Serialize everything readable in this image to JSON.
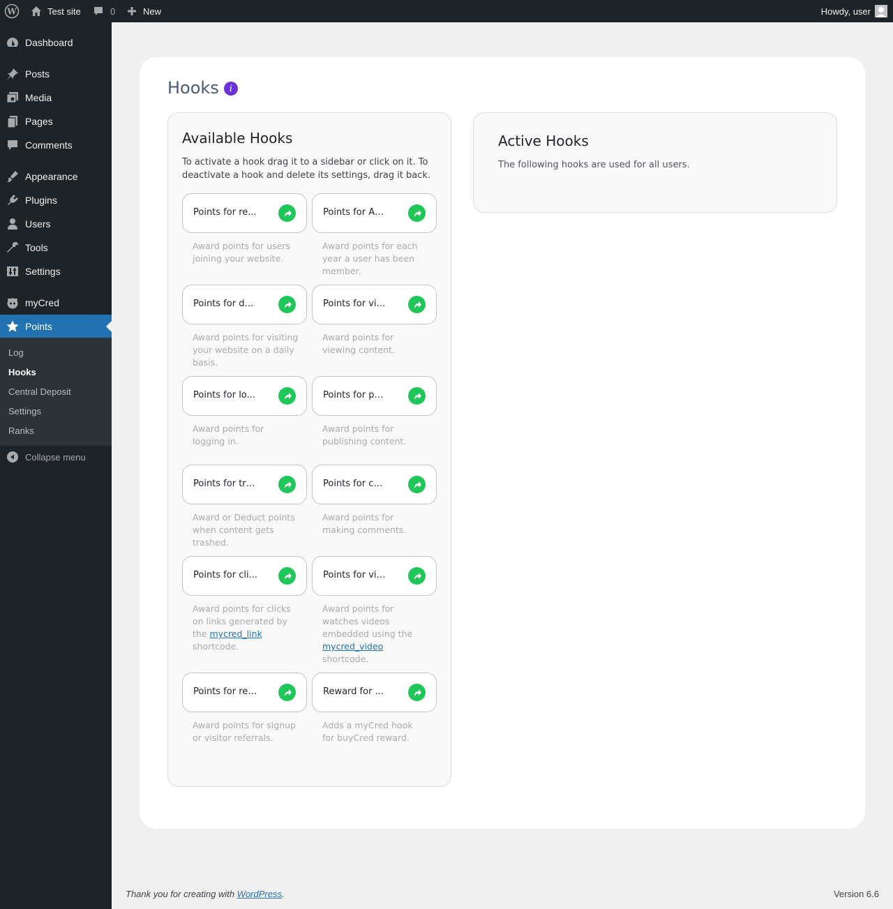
{
  "adminbar": {
    "site_name": "Test site",
    "comments_count": "0",
    "new_label": "New",
    "howdy": "Howdy, user"
  },
  "sidebar": {
    "items": [
      {
        "label": "Dashboard",
        "icon": "dashboard-icon"
      },
      {
        "label": "Posts",
        "icon": "pin-icon"
      },
      {
        "label": "Media",
        "icon": "media-icon"
      },
      {
        "label": "Pages",
        "icon": "pages-icon"
      },
      {
        "label": "Comments",
        "icon": "comment-icon"
      },
      {
        "label": "Appearance",
        "icon": "brush-icon"
      },
      {
        "label": "Plugins",
        "icon": "plug-icon"
      },
      {
        "label": "Users",
        "icon": "user-icon"
      },
      {
        "label": "Tools",
        "icon": "wrench-icon"
      },
      {
        "label": "Settings",
        "icon": "sliders-icon"
      },
      {
        "label": "myCred",
        "icon": "mycred-icon"
      },
      {
        "label": "Points",
        "icon": "star-icon"
      }
    ],
    "submenu": [
      "Log",
      "Hooks",
      "Central Deposit",
      "Settings",
      "Ranks"
    ],
    "collapse_label": "Collapse menu"
  },
  "page": {
    "title": "Hooks",
    "info_glyph": "i"
  },
  "available": {
    "title": "Available Hooks",
    "desc_line1": "To activate a hook drag it to a sidebar or click on it. To",
    "desc_line2": "deactivate a hook and delete its settings, drag it back.",
    "hooks": [
      {
        "title": "Points for re...",
        "desc": [
          "Award points for users",
          "joining your website."
        ]
      },
      {
        "title": "Points for An...",
        "desc": [
          "Award points for each",
          "year a user has been",
          "member."
        ]
      },
      {
        "title": "Points for da...",
        "desc": [
          "Award points for visiting",
          "your website on a daily",
          "basis."
        ]
      },
      {
        "title": "Points for vie...",
        "desc": [
          "Award points for",
          "viewing content."
        ]
      },
      {
        "title": "Points for lo...",
        "desc": [
          "Award points for",
          "logging in."
        ]
      },
      {
        "title": "Points for pu...",
        "desc": [
          "Award points for",
          "publishing content."
        ]
      },
      {
        "title": "Points for tra...",
        "desc": [
          "Award or Deduct points",
          "when content gets",
          "trashed."
        ]
      },
      {
        "title": "Points for co...",
        "desc": [
          "Award points for",
          "making comments."
        ]
      },
      {
        "title": "Points for cli...",
        "desc_prefix": [
          "Award points for clicks",
          "on links generated by",
          "the "
        ],
        "desc_link": "mycred_link",
        "desc_suffix": "shortcode."
      },
      {
        "title": "Points for vie...",
        "desc_prefix": [
          "Award points for",
          "watches videos",
          "embedded using the"
        ],
        "desc_link": "mycred_video",
        "desc_suffix": "shortcode."
      },
      {
        "title": "Points for ref...",
        "desc": [
          "Award points for signup",
          "or visitor referrals."
        ]
      },
      {
        "title": "Reward for ...",
        "desc": [
          "Adds a myCred hook",
          "for buyCred reward."
        ]
      }
    ]
  },
  "active": {
    "title": "Active Hooks",
    "desc": "The following hooks are used for all users."
  },
  "footer": {
    "thanks_prefix": "Thank you for creating with ",
    "thanks_link": "WordPress",
    "thanks_suffix": ".",
    "version": "Version 6.6"
  },
  "colors": {
    "accent": "#2271b1",
    "hook_button": "#1ec757",
    "info_badge": "#6a32d8",
    "adminbar_bg": "#1d2327"
  }
}
